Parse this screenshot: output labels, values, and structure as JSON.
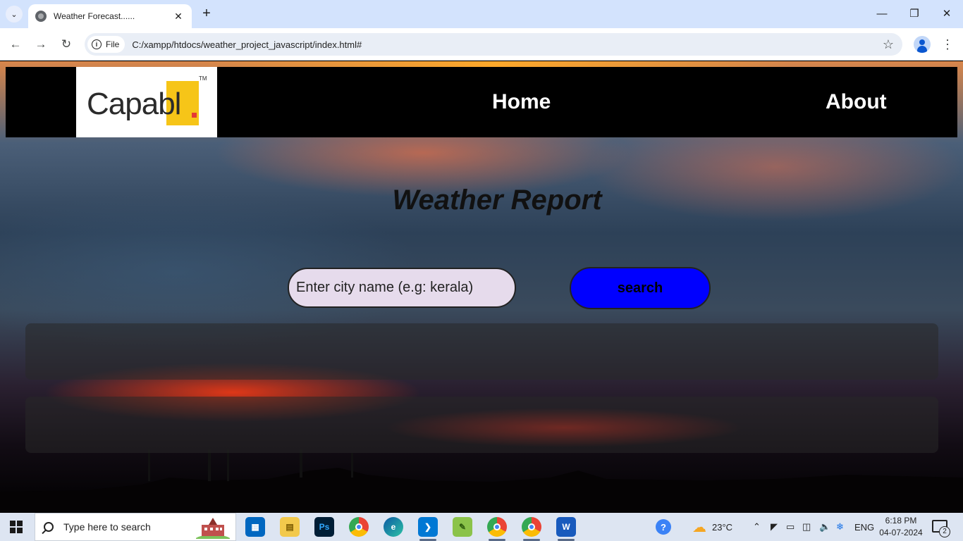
{
  "browser": {
    "tab_title": "Weather Forecast......",
    "new_tab_symbol": "+",
    "scheme_chip": "File",
    "url": "C:/xampp/htdocs/weather_project_javascript/index.html#"
  },
  "page": {
    "logo_text": "Capabl",
    "logo_tm": "TM",
    "nav": {
      "home": "Home",
      "about": "About"
    },
    "title": "Weather Report",
    "search": {
      "placeholder": "Enter city name (e.g: kerala)",
      "button_label": "search"
    }
  },
  "taskbar": {
    "search_placeholder": "Type here to search",
    "weather_temp": "23°C",
    "language": "ENG",
    "time": "6:18 PM",
    "date": "04-07-2024",
    "notification_count": "2",
    "apps": [
      "microsoft-store",
      "file-explorer",
      "photoshop",
      "chrome",
      "edge",
      "vs-code",
      "notepad-plus",
      "chrome-profile",
      "chrome",
      "word"
    ]
  },
  "colors": {
    "tab_bar": "#d3e3fd",
    "navbar_bg": "#000000",
    "search_button": "#0000ff",
    "input_bg": "#e6dbec",
    "logo_yellow": "#f6c518"
  }
}
